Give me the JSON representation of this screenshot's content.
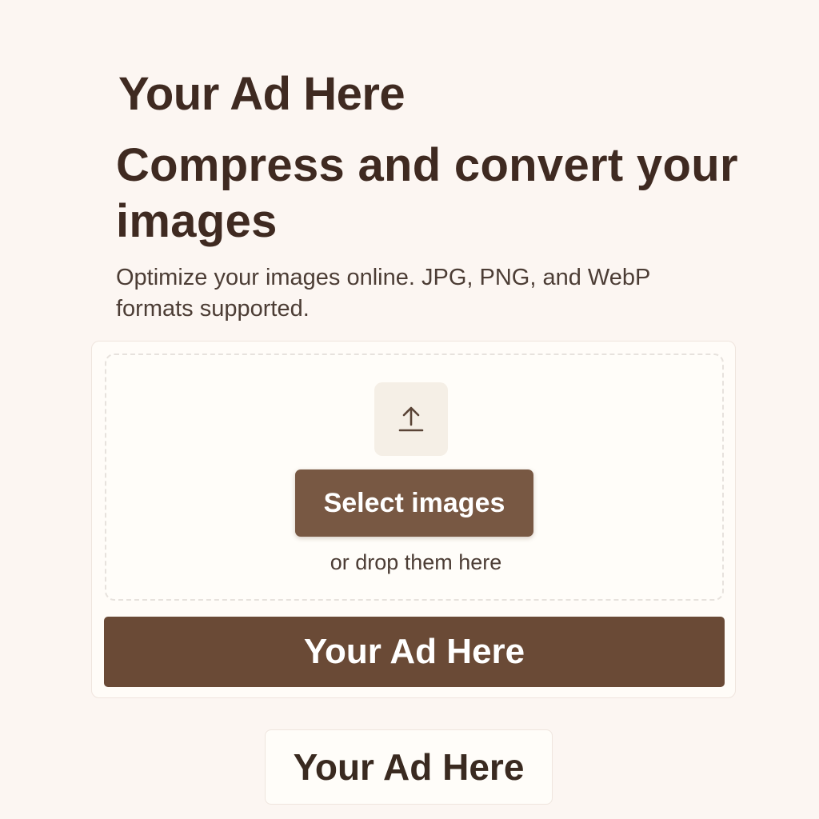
{
  "ads": {
    "top_label": "Your Ad Here",
    "card_banner_label": "Your Ad Here",
    "bottom_label": "Your Ad Here"
  },
  "hero": {
    "title": "Compress and convert your images",
    "subtitle": "Optimize your images online. JPG, PNG, and WebP formats supported."
  },
  "upload": {
    "icon": "upload-icon",
    "button_label": "Select images",
    "drop_hint": "or drop them here"
  },
  "colors": {
    "background": "#fcf6f2",
    "text_primary": "#3f2a21",
    "button": "#785843",
    "ad_banner": "#6a4a36"
  }
}
